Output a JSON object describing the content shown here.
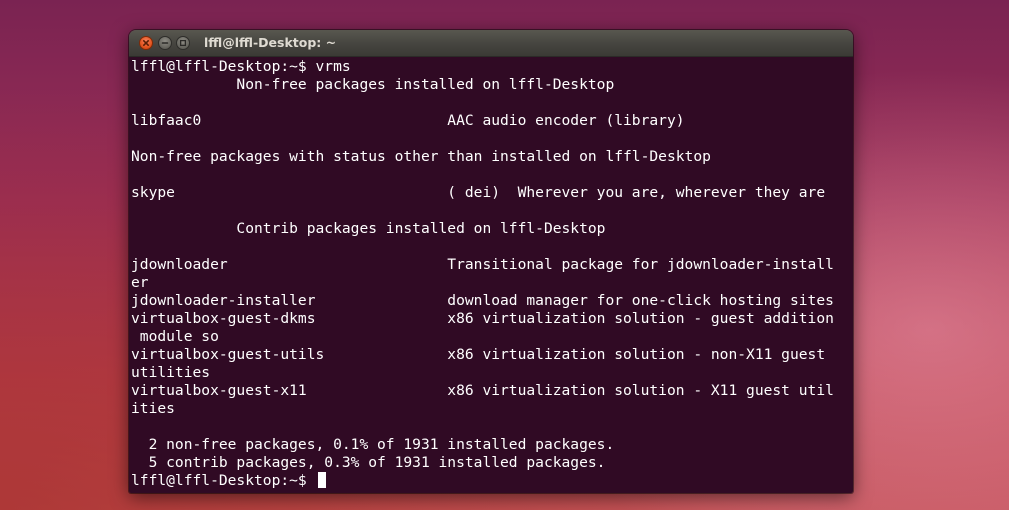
{
  "window": {
    "title": "lffl@lffl-Desktop: ~"
  },
  "terminal": {
    "lines": [
      "lffl@lffl-Desktop:~$ vrms",
      "            Non-free packages installed on lffl-Desktop",
      "",
      "libfaac0                            AAC audio encoder (library)",
      "",
      "Non-free packages with status other than installed on lffl-Desktop",
      "",
      "skype                               ( dei)  Wherever you are, wherever they are",
      "",
      "            Contrib packages installed on lffl-Desktop",
      "",
      "jdownloader                         Transitional package for jdownloader-install",
      "er",
      "jdownloader-installer               download manager for one-click hosting sites",
      "virtualbox-guest-dkms               x86 virtualization solution - guest addition",
      " module so",
      "virtualbox-guest-utils              x86 virtualization solution - non-X11 guest",
      "utilities",
      "virtualbox-guest-x11                x86 virtualization solution - X11 guest util",
      "ities",
      "",
      "  2 non-free packages, 0.1% of 1931 installed packages.",
      "  5 contrib packages, 0.3% of 1931 installed packages."
    ],
    "prompt": "lffl@lffl-Desktop:~$ "
  }
}
